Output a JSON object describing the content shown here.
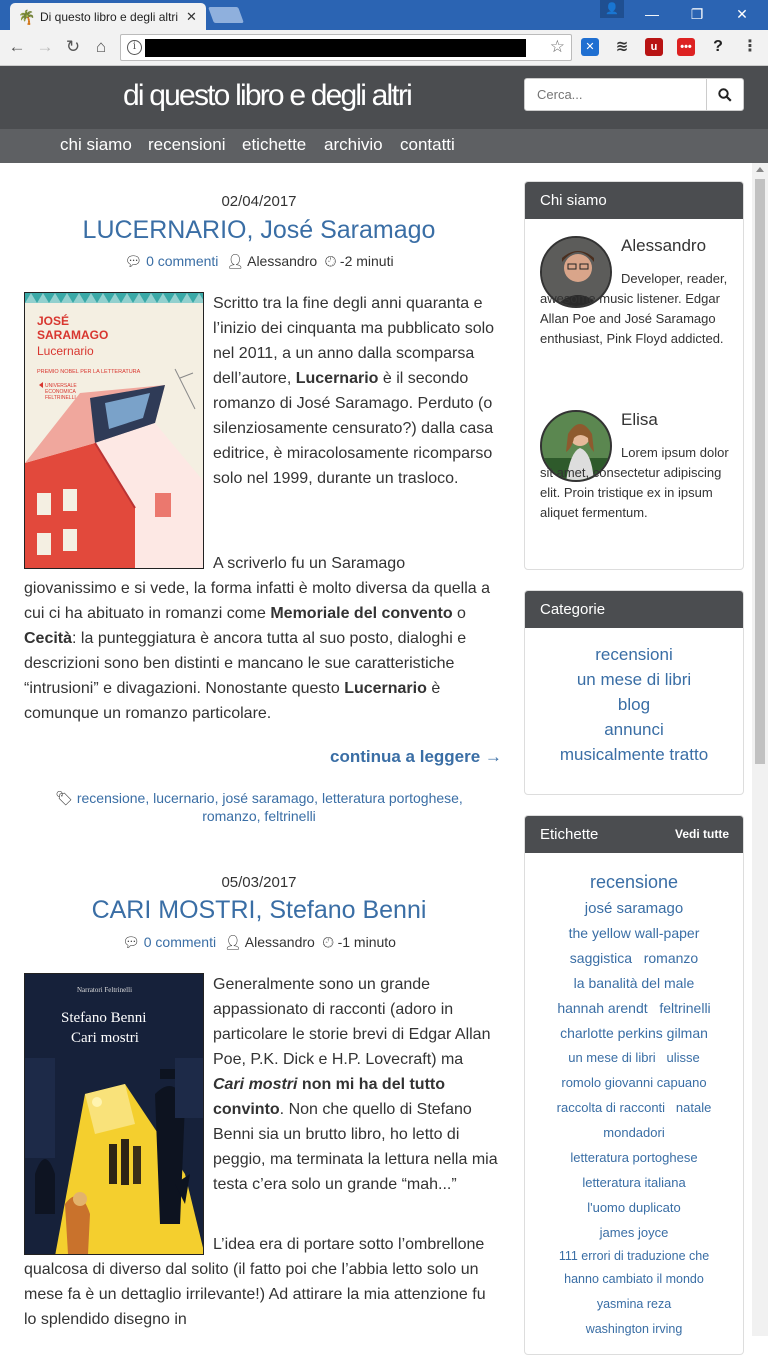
{
  "browser": {
    "tab_title": "Di questo libro e degli altri",
    "tab_close": "✕"
  },
  "site": {
    "title": "di questo libro e degli altri",
    "search_placeholder": "Cerca...",
    "nav": [
      "chi siamo",
      "recensioni",
      "etichette",
      "archivio",
      "contatti"
    ]
  },
  "posts": [
    {
      "date": "02/04/2017",
      "title": "LUCERNARIO, José Saramago",
      "comments": "0 commenti",
      "author": "Alessandro",
      "time": "-2 minuti",
      "para1_a": "Scritto tra la fine degli anni quaranta e l’inizio dei cinquanta ma pubblicato solo nel 2011, a un anno dalla scomparsa dell’autore, ",
      "para1_b": "Lucernario",
      "para1_c": " è il secondo romanzo di José Saramago. Perduto (o silenziosamente censurato?) dalla casa editrice, è miracolosamente ricomparso solo nel 1999, durante un trasloco.",
      "para2_a": "A scriverlo fu un Saramago giovanissimo e si vede, la forma infatti è molto diversa da quella a cui ci ha abituato in romanzi come ",
      "para2_b": "Memoriale del convento",
      "para2_c": " o ",
      "para2_d": "Cecità",
      "para2_e": ": la punteggiatura è ancora tutta al suo posto, dialoghi e descrizioni sono ben distinti e mancano le sue caratteristiche “intrusioni” e divagazioni. Nonostante questo ",
      "para2_f": "Lucernario",
      "para2_g": " è comunque un romanzo particolare.",
      "continue": "continua a leggere →",
      "tags_line1": "recensione, lucernario, josé saramago, letteratura portoghese,",
      "tags_line2": "romanzo, feltrinelli",
      "cover_author": "JOSÉ SARAMAGO",
      "cover_title": "Lucernario",
      "cover_sub": "PREMIO NOBEL PER LA LETTERATURA",
      "cover_pub": "UNIVERSALE ECONOMICA FELTRINELLI"
    },
    {
      "date": "05/03/2017",
      "title": "CARI MOSTRI, Stefano Benni",
      "comments": "0 commenti",
      "author": "Alessandro",
      "time": "-1 minuto",
      "para1_a": "Generalmente sono un grande appassionato di racconti (adoro in particolare le storie brevi di Edgar Allan Poe, P.K. Dick e H.P. Lovecraft) ma ",
      "para1_b": "Cari mostri",
      "para1_c": " non mi ha del tutto convinto",
      "para1_d": ". Non che quello di Stefano Benni sia un brutto libro, ho letto di peggio, ma terminata la lettura nella mia testa c’era solo un grande “mah...”",
      "para2": "L’idea era di portare sotto l’ombrellone qualcosa di diverso dal solito (il fatto poi che l’abbia letto solo un mese fa è un dettaglio irrilevante!) Ad attirare la mia attenzione fu lo splendido disegno in",
      "cover_header": "Narratori  Feltrinelli",
      "cover_author": "Stefano Benni",
      "cover_title": "Cari mostri"
    }
  ],
  "sidebar": {
    "about": {
      "heading": "Chi siamo",
      "people": [
        {
          "name": "Alessandro",
          "bio": "Developer, reader, awesome music listener. Edgar Allan Poe and José Saramago enthusiast, Pink Floyd addicted."
        },
        {
          "name": "Elisa",
          "bio": "Lorem ipsum dolor sit amet, consectetur adipiscing elit. Proin tristique ex in ipsum aliquet fermentum."
        }
      ]
    },
    "categories": {
      "heading": "Categorie",
      "items": [
        "recensioni",
        "un mese di libri",
        "blog",
        "annunci",
        "musicalmente tratto"
      ]
    },
    "labels": {
      "heading": "Etichette",
      "see_all": "Vedi tutte",
      "items": [
        "recensione",
        "josé saramago",
        "the yellow wall-paper",
        "saggistica",
        "romanzo",
        "la banalità del male",
        "hannah arendt",
        "feltrinelli",
        "charlotte perkins gilman",
        "un mese di libri",
        "ulisse",
        "romolo giovanni capuano",
        "raccolta di racconti",
        "natale",
        "mondadori",
        "letteratura portoghese",
        "letteratura italiana",
        "l'uomo duplicato",
        "james joyce",
        "111 errori di traduzione che",
        "hanno cambiato il mondo",
        "yasmina reza",
        "washington irving"
      ]
    }
  }
}
